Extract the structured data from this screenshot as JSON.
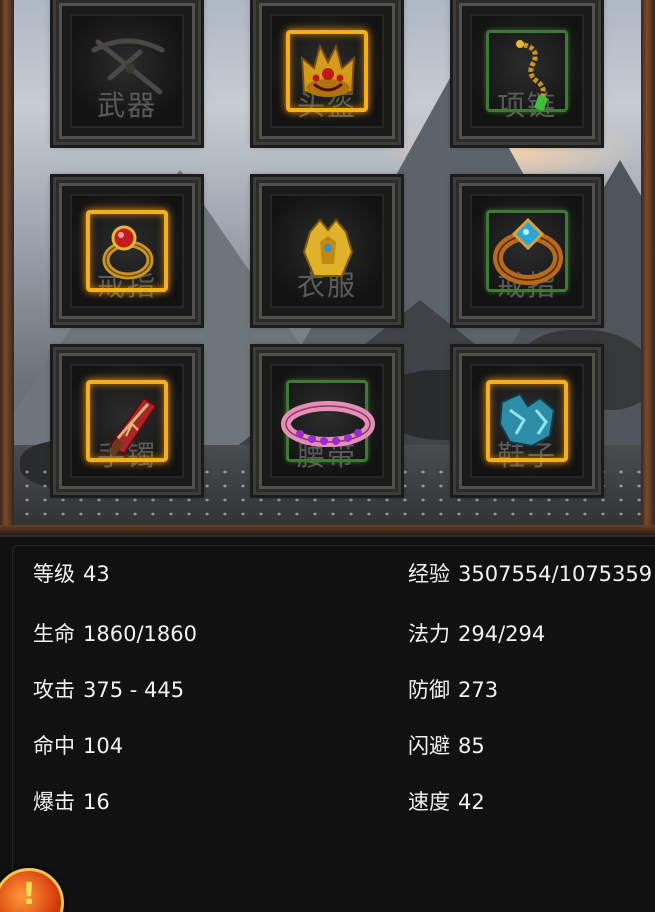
{
  "equipment": {
    "slots": [
      {
        "label": "武器",
        "item": "crossbow-icon",
        "rarity": "none"
      },
      {
        "label": "头盔",
        "item": "helmet-crown-icon",
        "rarity": "gold"
      },
      {
        "label": "项链",
        "item": "necklace-icon",
        "rarity": "green"
      },
      {
        "label": "戒指",
        "item": "ruby-ring-icon",
        "rarity": "gold"
      },
      {
        "label": "衣服",
        "item": "golden-armor-icon",
        "rarity": "none"
      },
      {
        "label": "戒指",
        "item": "sapphire-ring-icon",
        "rarity": "green"
      },
      {
        "label": "手镯",
        "item": "bracer-icon",
        "rarity": "gold"
      },
      {
        "label": "腰带",
        "item": "pink-belt-icon",
        "rarity": "green"
      },
      {
        "label": "鞋子",
        "item": "crystal-boots-icon",
        "rarity": "gold"
      }
    ]
  },
  "stats": {
    "level": {
      "label": "等级",
      "value": "43"
    },
    "exp": {
      "label": "经验",
      "value": "3507554/1075359"
    },
    "hp": {
      "label": "生命",
      "value": "1860/1860"
    },
    "mp": {
      "label": "法力",
      "value": "294/294"
    },
    "attack": {
      "label": "攻击",
      "value": "375 - 445"
    },
    "defense": {
      "label": "防御",
      "value": "273"
    },
    "hit": {
      "label": "命中",
      "value": "104"
    },
    "dodge": {
      "label": "闪避",
      "value": "85"
    },
    "crit": {
      "label": "爆击",
      "value": "16"
    },
    "speed": {
      "label": "速度",
      "value": "42"
    }
  },
  "alert": {
    "icon": "alert-icon",
    "mark": "!"
  },
  "colors": {
    "rarity_gold": "#f2b01a",
    "rarity_green": "#3f7a34",
    "stat_text": "#f1f1f1",
    "panel_bg": "#101011"
  }
}
